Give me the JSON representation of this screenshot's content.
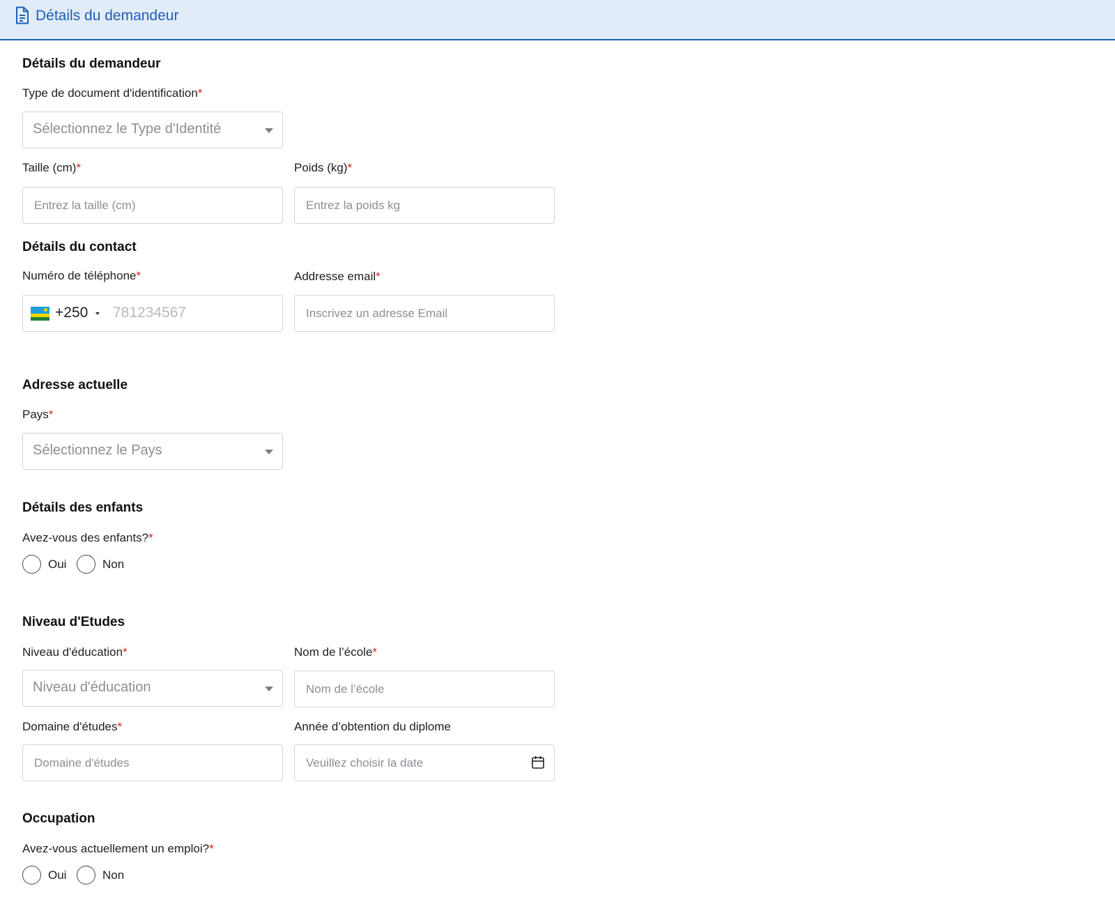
{
  "header": {
    "title": "Détails du demandeur"
  },
  "applicant": {
    "section_title": "Détails du demandeur",
    "id_type_label": "Type de document d'identification",
    "id_type_placeholder": "Sélectionnez le Type d'Identité",
    "height_label": "Taille (cm)",
    "height_placeholder": "Entrez la taille (cm)",
    "weight_label": "Poids (kg)",
    "weight_placeholder": "Entrez la poids kg"
  },
  "contact": {
    "section_title": "Détails du contact",
    "phone_label": "Numéro de téléphone",
    "phone_code": "+250",
    "phone_placeholder": "781234567",
    "email_label": "Addresse email",
    "email_placeholder": "Inscrivez un adresse Email"
  },
  "address": {
    "section_title": "Adresse actuelle",
    "country_label": "Pays",
    "country_placeholder": "Sélectionnez le Pays"
  },
  "children": {
    "section_title": "Détails des enfants",
    "question": "Avez-vous des enfants?",
    "yes": "Oui",
    "no": "Non"
  },
  "education": {
    "section_title": "Niveau d'Etudes",
    "level_label": "Niveau d'éducation",
    "level_placeholder": "Niveau d'éducation",
    "school_label": "Nom de l’école",
    "school_placeholder": "Nom de l’école",
    "field_label": "Domaine d'études",
    "field_placeholder": "Domaine d'études",
    "year_label": "Année d’obtention du diplome",
    "year_placeholder": "Veuillez choisir la date"
  },
  "occupation": {
    "section_title": "Occupation",
    "question": "Avez-vous actuellement un emploi?",
    "yes": "Oui",
    "no": "Non"
  },
  "required_marker": "*"
}
